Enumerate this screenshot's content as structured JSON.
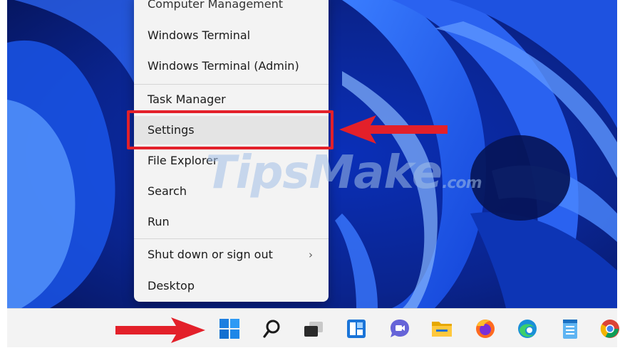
{
  "context_menu": {
    "partial_top_item": "Computer Management",
    "items": [
      {
        "label": "Windows Terminal"
      },
      {
        "label": "Windows Terminal (Admin)"
      },
      {
        "label": "Task Manager"
      },
      {
        "label": "Settings",
        "selected": true
      },
      {
        "label": "File Explorer"
      },
      {
        "label": "Search"
      },
      {
        "label": "Run"
      },
      {
        "label": "Shut down or sign out",
        "submenu": true
      },
      {
        "label": "Desktop"
      }
    ],
    "submenu_chevron": "›"
  },
  "annotations": {
    "highlight_color": "#e3202a",
    "arrows": [
      "pointing-to-settings",
      "pointing-to-start-button"
    ]
  },
  "watermark": {
    "text": "TipsMake",
    "suffix": ".com"
  },
  "taskbar": {
    "icons": [
      "windows-start-icon",
      "search-icon",
      "task-view-icon",
      "widgets-icon",
      "teams-chat-icon",
      "file-explorer-icon",
      "firefox-icon",
      "edge-icon",
      "notepad-icon",
      "chrome-icon"
    ]
  },
  "colors": {
    "wallpaper_dark": "#071a63",
    "wallpaper_bright": "#2b6bff",
    "menu_bg": "#f3f3f3",
    "taskbar_bg": "#f3f3f3"
  }
}
